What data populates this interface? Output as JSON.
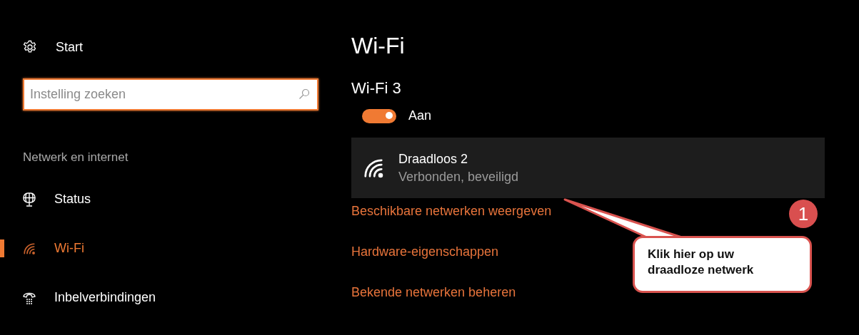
{
  "sidebar": {
    "header": {
      "label": "Start"
    },
    "search": {
      "placeholder": "Instelling zoeken"
    },
    "section_title": "Netwerk en internet",
    "items": [
      {
        "label": "Status",
        "selected": false
      },
      {
        "label": "Wi-Fi",
        "selected": true
      },
      {
        "label": "Inbelverbindingen",
        "selected": false
      }
    ]
  },
  "content": {
    "title": "Wi-Fi",
    "adapter": "Wi-Fi 3",
    "toggle": {
      "on": true,
      "label": "Aan"
    },
    "network": {
      "name": "Draadloos 2",
      "status": "Verbonden, beveiligd"
    },
    "links": [
      "Beschikbare netwerken weergeven",
      "Hardware-eigenschappen",
      "Bekende netwerken beheren"
    ]
  },
  "callout": {
    "badge": "1",
    "text": "Klik hier op uw draadloze netwerk"
  }
}
